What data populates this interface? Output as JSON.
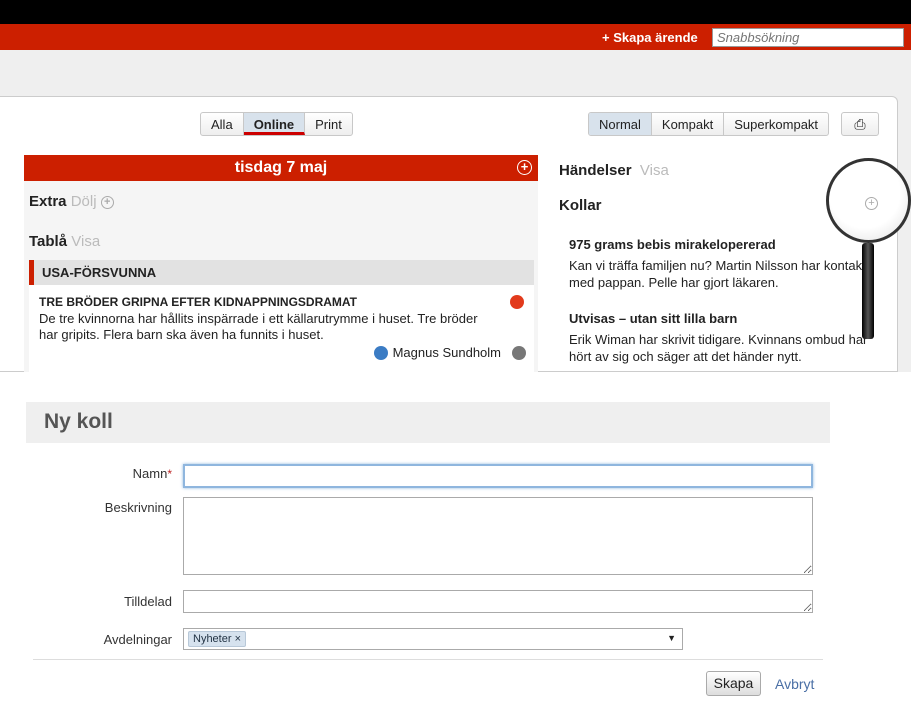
{
  "topnav": {
    "create_label": "+ Skapa ärende",
    "search_placeholder": "Snabbsökning"
  },
  "filters": {
    "items": [
      "Alla",
      "Online",
      "Print"
    ],
    "selected": "Online"
  },
  "view_modes": {
    "items": [
      "Normal",
      "Kompakt",
      "Superkompakt"
    ],
    "selected": "Normal",
    "print_icon": "printer-icon"
  },
  "day": {
    "title": "tisdag 7 maj",
    "extra": {
      "label": "Extra",
      "action": "Dölj"
    },
    "tabla": {
      "label": "Tablå",
      "action": "Visa"
    },
    "story_group": "USA-FÖRSVUNNA",
    "story": {
      "title": "TRE BRÖDER GRIPNA EFTER KIDNAPPNINGSDRAMAT",
      "text": "De tre kvinnorna har hållits inspärrade i ett källarutrymme i huset. Tre bröder har gripits. Flera barn ska även ha funnits i huset.",
      "author": "Magnus Sundholm",
      "status_color": "#e23a1c"
    }
  },
  "right": {
    "handelser": {
      "label": "Händelser",
      "action": "Visa"
    },
    "kollar": {
      "label": "Kollar",
      "items": [
        {
          "title": "975 grams bebis mirakelopererad",
          "text": "Kan vi träffa familjen nu? Martin Nilsson har kontakt med pappan. Pelle har gjort läkaren."
        },
        {
          "title": "Utvisas – utan sitt lilla barn",
          "text": "Erik Wiman har skrivit tidigare. Kvinnans ombud har hört av sig och säger att det händer nytt."
        }
      ]
    }
  },
  "form": {
    "title": "Ny koll",
    "name_label": "Namn",
    "required_mark": "*",
    "description_label": "Beskrivning",
    "assigned_label": "Tilldelad",
    "departments_label": "Avdelningar",
    "departments_tags": [
      "Nyheter"
    ],
    "tag_remove": "×",
    "submit": "Skapa",
    "cancel": "Avbryt"
  },
  "colors": {
    "brand_red": "#cc1f00",
    "link": "#4a6fa5"
  }
}
